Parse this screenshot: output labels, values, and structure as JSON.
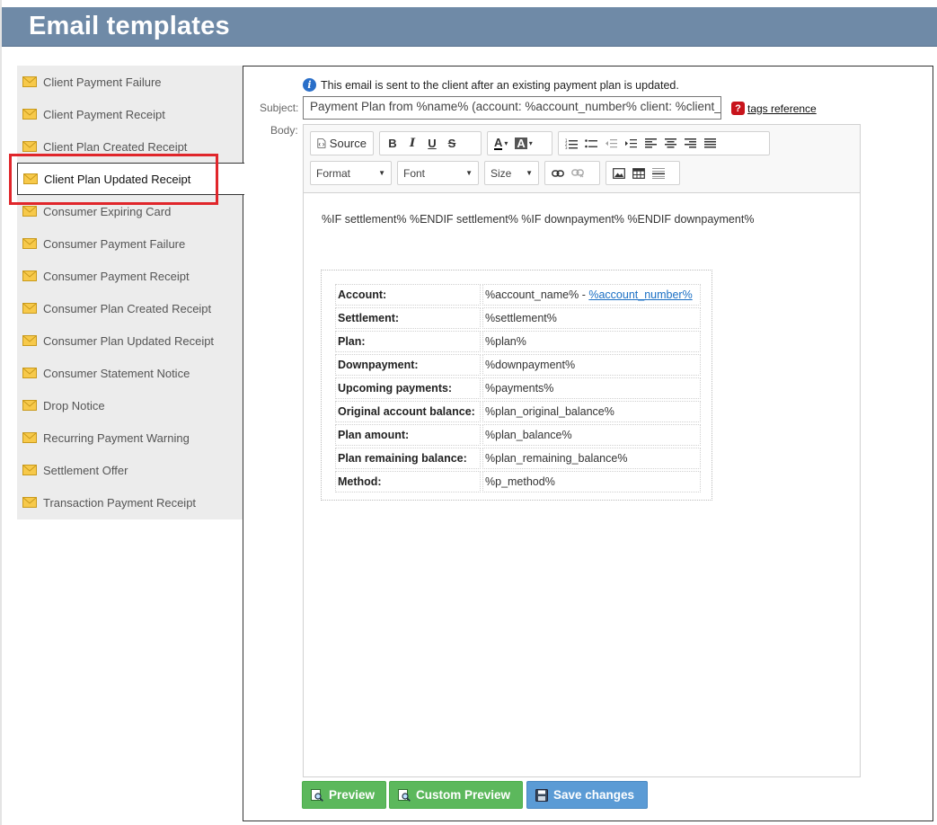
{
  "page": {
    "title": "Email templates"
  },
  "sidebar": {
    "items": [
      {
        "label": "Client Payment Failure"
      },
      {
        "label": "Client Payment Receipt"
      },
      {
        "label": "Client Plan Created Receipt"
      },
      {
        "label": "Client Plan Updated Receipt",
        "active": true
      },
      {
        "label": "Consumer Expiring Card"
      },
      {
        "label": "Consumer Payment Failure"
      },
      {
        "label": "Consumer Payment Receipt"
      },
      {
        "label": "Consumer Plan Created Receipt"
      },
      {
        "label": "Consumer Plan Updated Receipt"
      },
      {
        "label": "Consumer Statement Notice"
      },
      {
        "label": "Drop Notice"
      },
      {
        "label": "Recurring Payment Warning"
      },
      {
        "label": "Settlement Offer"
      },
      {
        "label": "Transaction Payment Receipt"
      }
    ]
  },
  "editor": {
    "info": "This email is sent to the client after an existing payment plan is updated.",
    "subject_label": "Subject:",
    "subject_value": "Payment Plan from %name% (account: %account_number% client: %client_name%)",
    "tags_reference": "tags reference",
    "body_label": "Body:",
    "toolbar": {
      "source": "Source",
      "format": "Format",
      "font": "Font",
      "size": "Size"
    },
    "body": {
      "conditional_line": "%IF settlement% %ENDIF settlement% %IF downpayment% %ENDIF downpayment%",
      "rows": [
        {
          "key": "Account:",
          "value": "%account_name% - ",
          "link": "%account_number%"
        },
        {
          "key": "Settlement:",
          "value": "%settlement%"
        },
        {
          "key": "Plan:",
          "value": "%plan%"
        },
        {
          "key": "Downpayment:",
          "value": "%downpayment%"
        },
        {
          "key": "Upcoming payments:",
          "value": "%payments%"
        },
        {
          "key": "Original account balance:",
          "value": "%plan_original_balance%"
        },
        {
          "key": "Plan amount:",
          "value": "%plan_balance%"
        },
        {
          "key": "Plan remaining balance:",
          "value": "%plan_remaining_balance%"
        },
        {
          "key": "Method:",
          "value": "%p_method%"
        }
      ]
    }
  },
  "actions": {
    "preview": "Preview",
    "custom_preview": "Custom Preview",
    "save": "Save changes"
  },
  "colors": {
    "header_bg": "#6f8aa7",
    "selection_outline": "#e0262b",
    "green_button": "#5cb85c",
    "blue_button": "#5b9bd5",
    "link": "#1a6fc4"
  }
}
